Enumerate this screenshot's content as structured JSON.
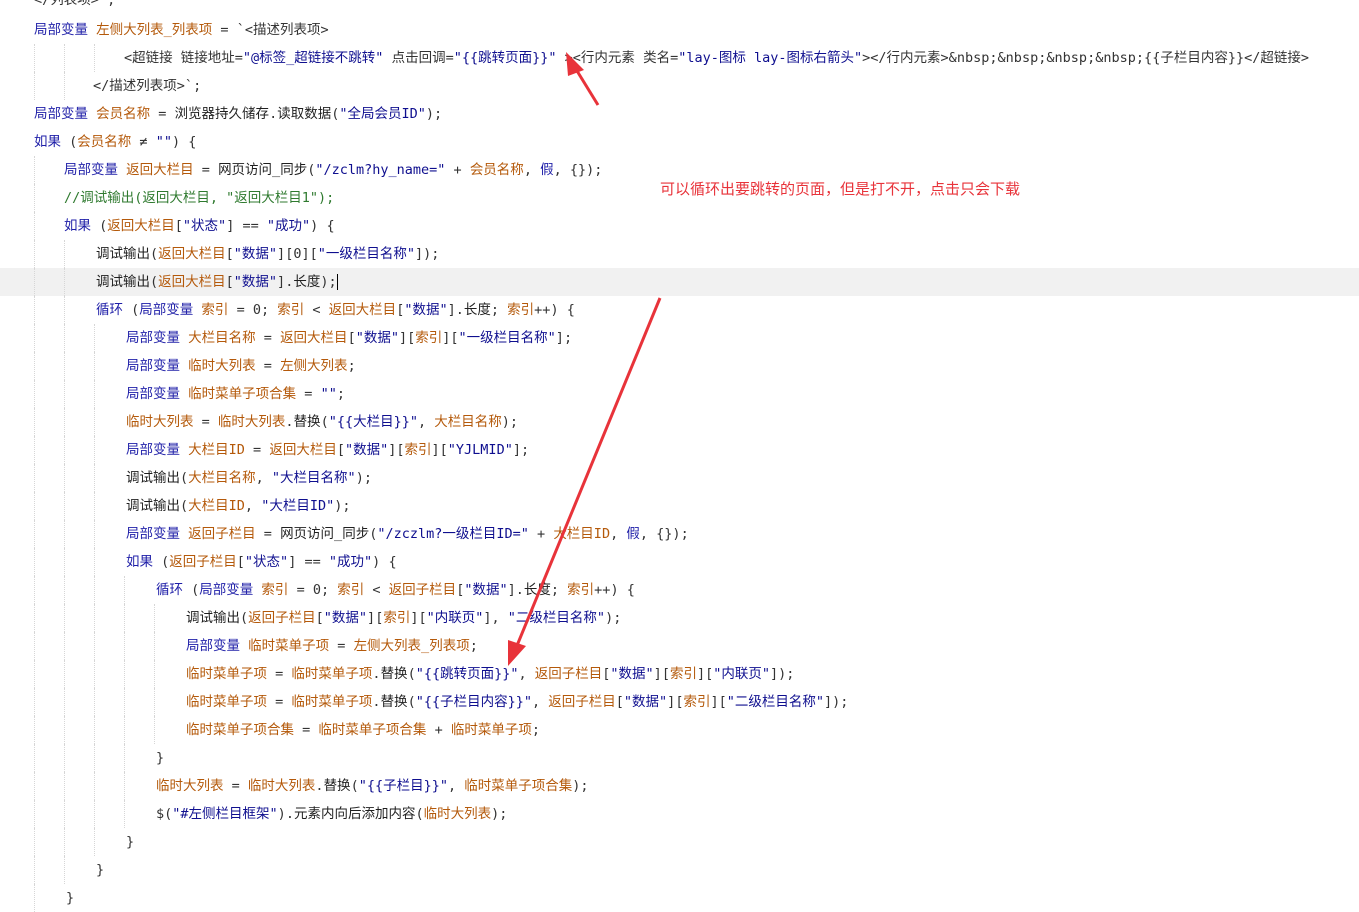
{
  "annotation": {
    "note": "可以循环出要跳转的页面，但是打不开，点击只会下载",
    "color": "#e8333a"
  },
  "code_lines": [
    "</列表项>`;",
    "局部变量 左侧大列表_列表项 = `<描述列表项>",
    "<超链接 链接地址=\"@标签_超链接不跳转\" 点击回调=\"{{跳转页面}}\" ><行内元素 类名=\"lay-图标 lay-图标右箭头\"></行内元素>&nbsp;&nbsp;&nbsp;&nbsp;{{子栏目内容}}</超链接>",
    "</描述列表项>`;",
    "局部变量 会员名称 = 浏览器持久储存.读取数据(\"全局会员ID\");",
    "如果 (会员名称 ≠ \"\") {",
    "局部变量 返回大栏目 = 网页访问_同步(\"/zclm?hy_name=\" + 会员名称, 假, {});",
    "//调试输出(返回大栏目, \"返回大栏目1\");",
    "如果 (返回大栏目[\"状态\"] == \"成功\") {",
    "调试输出(返回大栏目[\"数据\"][0][\"一级栏目名称\"]);",
    "调试输出(返回大栏目[\"数据\"].长度);",
    "循环 (局部变量 索引 = 0; 索引 < 返回大栏目[\"数据\"].长度; 索引++) {",
    "局部变量 大栏目名称 = 返回大栏目[\"数据\"][索引][\"一级栏目名称\"];",
    "局部变量 临时大列表 = 左侧大列表;",
    "局部变量 临时菜单子项合集 = \"\";",
    "临时大列表 = 临时大列表.替换(\"{{大栏目}}\", 大栏目名称);",
    "局部变量 大栏目ID = 返回大栏目[\"数据\"][索引][\"YJLMID\"];",
    "调试输出(大栏目名称, \"大栏目名称\");",
    "调试输出(大栏目ID, \"大栏目ID\");",
    "局部变量 返回子栏目 = 网页访问_同步(\"/zczlm?一级栏目ID=\" + 大栏目ID, 假, {});",
    "如果 (返回子栏目[\"状态\"] == \"成功\") {",
    "循环 (局部变量 索引 = 0; 索引 < 返回子栏目[\"数据\"].长度; 索引++) {",
    "调试输出(返回子栏目[\"数据\"][索引][\"内联页\"], \"二级栏目名称\");",
    "局部变量 临时菜单子项 = 左侧大列表_列表项;",
    "临时菜单子项 = 临时菜单子项.替换(\"{{跳转页面}}\", 返回子栏目[\"数据\"][索引][\"内联页\"]);",
    "临时菜单子项 = 临时菜单子项.替换(\"{{子栏目内容}}\", 返回子栏目[\"数据\"][索引][\"二级栏目名称\"]);",
    "临时菜单子项合集 = 临时菜单子项合集 + 临时菜单子项;",
    "}",
    "临时大列表 = 临时大列表.替换(\"{{子栏目}}\", 临时菜单子项合集);",
    "$(\"#左侧栏目框架\").元素内向后添加内容(临时大列表);",
    "}",
    "}",
    "}"
  ]
}
